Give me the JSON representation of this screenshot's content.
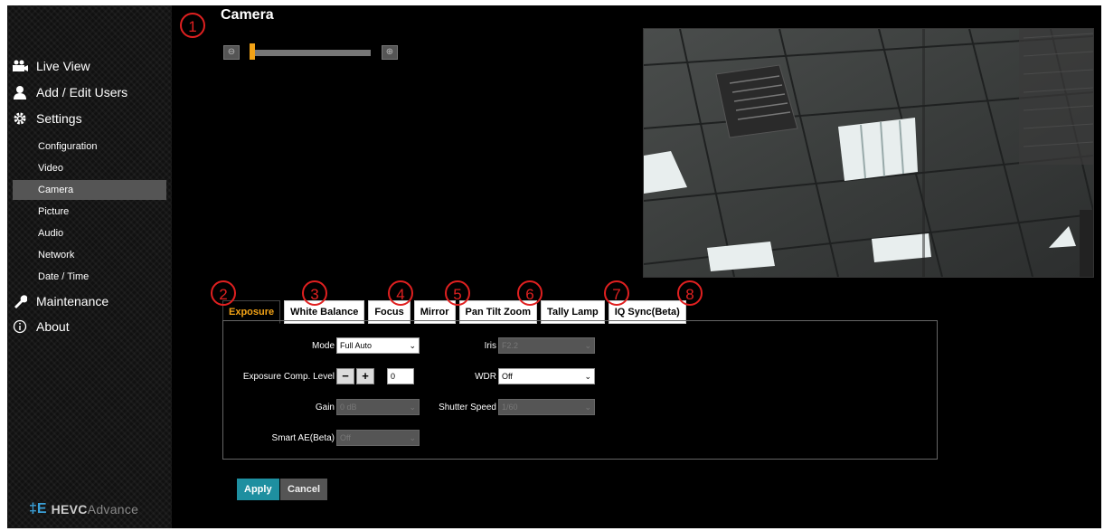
{
  "page": {
    "title": "Camera"
  },
  "sidebar": {
    "main_items": [
      {
        "label": "Live View",
        "icon": "live-view-icon"
      },
      {
        "label": "Add / Edit Users",
        "icon": "user-icon"
      },
      {
        "label": "Settings",
        "icon": "gear-icon"
      },
      {
        "label": "Maintenance",
        "icon": "wrench-icon"
      },
      {
        "label": "About",
        "icon": "info-icon"
      }
    ],
    "settings_items": [
      "Configuration",
      "Video",
      "Camera",
      "Picture",
      "Audio",
      "Network",
      "Date / Time"
    ],
    "active_item": "Camera",
    "logo": {
      "prefix": "HEVC",
      "suffix": "Advance"
    }
  },
  "zoom": {
    "level": 0.02,
    "out_icon": "zoom-out-icon",
    "in_icon": "zoom-in-icon"
  },
  "markers": [
    "1",
    "2",
    "3",
    "4",
    "5",
    "6",
    "7",
    "8"
  ],
  "tabs": [
    {
      "label": "Exposure",
      "active": true
    },
    {
      "label": "White Balance"
    },
    {
      "label": "Focus"
    },
    {
      "label": "Mirror"
    },
    {
      "label": "Pan Tilt Zoom"
    },
    {
      "label": "Tally Lamp"
    },
    {
      "label": "IQ Sync(Beta)"
    }
  ],
  "exposure": {
    "mode_label": "Mode",
    "mode_value": "Full Auto",
    "comp_label": "Exposure Comp. Level",
    "comp_value": "0",
    "gain_label": "Gain",
    "gain_value": "0 dB",
    "smart_ae_label": "Smart AE(Beta)",
    "smart_ae_value": "Off",
    "iris_label": "Iris",
    "iris_value": "F2.2",
    "wdr_label": "WDR",
    "wdr_value": "Off",
    "shutter_label": "Shutter Speed",
    "shutter_value": "1/60"
  },
  "actions": {
    "apply": "Apply",
    "cancel": "Cancel"
  },
  "colors": {
    "accent": "#f2a216",
    "apply": "#1e8fa0",
    "marker": "#e02020"
  }
}
